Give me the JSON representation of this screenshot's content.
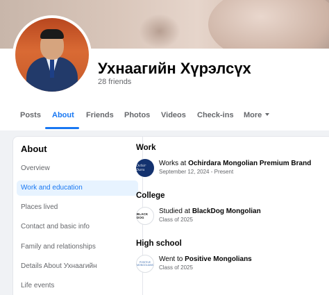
{
  "profile": {
    "name": "Ухнаагийн Хүрэлсүх",
    "friends": "28 friends"
  },
  "tabs": [
    {
      "label": "Posts",
      "active": false
    },
    {
      "label": "About",
      "active": true
    },
    {
      "label": "Friends",
      "active": false
    },
    {
      "label": "Photos",
      "active": false
    },
    {
      "label": "Videos",
      "active": false
    },
    {
      "label": "Check-ins",
      "active": false
    },
    {
      "label": "More",
      "active": false
    }
  ],
  "about": {
    "title": "About",
    "nav": [
      {
        "label": "Overview",
        "selected": false
      },
      {
        "label": "Work and education",
        "selected": true
      },
      {
        "label": "Places lived",
        "selected": false
      },
      {
        "label": "Contact and basic info",
        "selected": false
      },
      {
        "label": "Family and relationships",
        "selected": false
      },
      {
        "label": "Details About Ухнаагийн",
        "selected": false
      },
      {
        "label": "Life events",
        "selected": false
      }
    ]
  },
  "sections": {
    "work": {
      "title": "Work",
      "prefix": "Works at",
      "org": "Ochirdara Mongolian Premium Brand",
      "sub": "September 12, 2024 - Present",
      "icon_text": "Ochir Dara"
    },
    "college": {
      "title": "College",
      "prefix": "Studied at",
      "org": "BlackDog Mongolian",
      "sub": "Class of 2025",
      "icon_text": "BLACK DOG"
    },
    "high_school": {
      "title": "High school",
      "prefix": "Went to",
      "org": "Positive Mongolians",
      "sub": "Class of 2025",
      "icon_text": "POSITIVE MONGOLIANS"
    }
  },
  "colors": {
    "accent": "#1877f2",
    "selected_bg": "#e7f3ff",
    "muted_text": "#65676b",
    "page_bg": "#f0f2f5"
  },
  "icons": {
    "more_caret": "caret-down-icon"
  }
}
